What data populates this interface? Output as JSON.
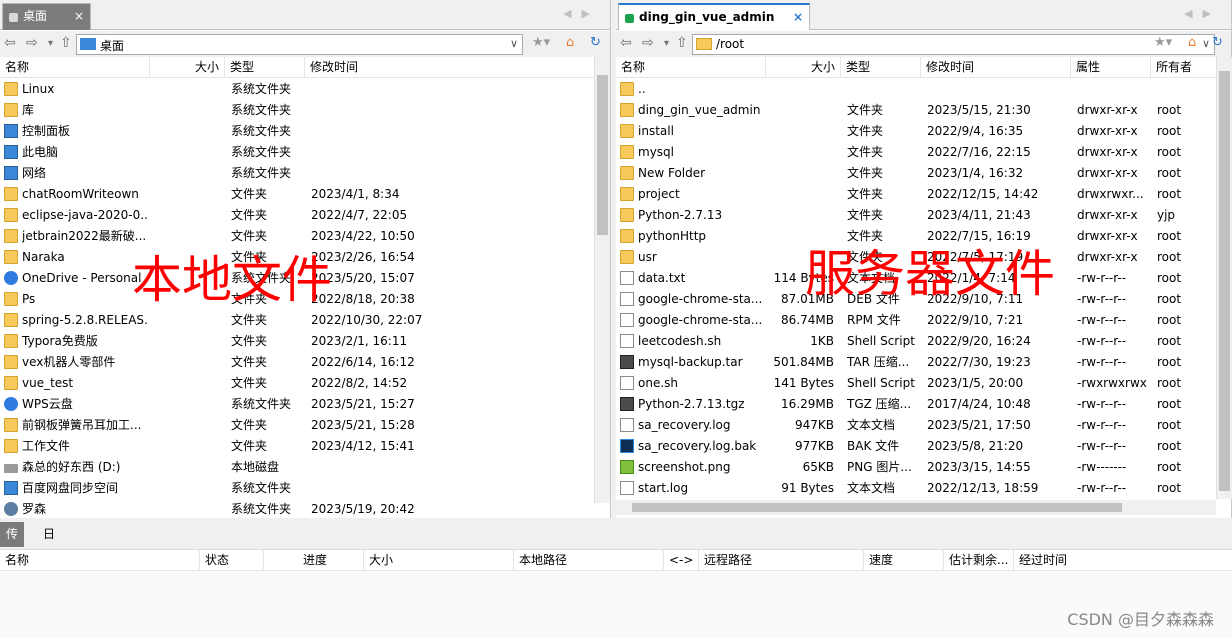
{
  "left": {
    "tab_label": "桌面",
    "path": "桌面",
    "columns": [
      "名称",
      "大小",
      "类型",
      "修改时间"
    ],
    "rows": [
      {
        "name": "Linux",
        "icon": "folder-icon",
        "size": "",
        "type": "系统文件夹",
        "mtime": ""
      },
      {
        "name": "库",
        "icon": "library-icon",
        "size": "",
        "type": "系统文件夹",
        "mtime": ""
      },
      {
        "name": "控制面板",
        "icon": "control-panel-icon",
        "size": "",
        "type": "系统文件夹",
        "mtime": ""
      },
      {
        "name": "此电脑",
        "icon": "computer-icon",
        "size": "",
        "type": "系统文件夹",
        "mtime": ""
      },
      {
        "name": "网络",
        "icon": "network-icon",
        "size": "",
        "type": "系统文件夹",
        "mtime": ""
      },
      {
        "name": "chatRoomWriteown",
        "icon": "folder-icon",
        "size": "",
        "type": "文件夹",
        "mtime": "2023/4/1, 8:34"
      },
      {
        "name": "eclipse-java-2020-0...",
        "icon": "folder-icon",
        "size": "",
        "type": "文件夹",
        "mtime": "2022/4/7, 22:05"
      },
      {
        "name": "jetbrain2022最新破...",
        "icon": "folder-icon",
        "size": "",
        "type": "文件夹",
        "mtime": "2023/4/22, 10:50"
      },
      {
        "name": "Naraka",
        "icon": "folder-icon",
        "size": "",
        "type": "文件夹",
        "mtime": "2023/2/26, 16:54"
      },
      {
        "name": "OneDrive - Personal",
        "icon": "onedrive-icon",
        "size": "",
        "type": "系统文件夹",
        "mtime": "2023/5/20, 15:07"
      },
      {
        "name": "Ps",
        "icon": "folder-icon",
        "size": "",
        "type": "文件夹",
        "mtime": "2022/8/18, 20:38"
      },
      {
        "name": "spring-5.2.8.RELEAS...",
        "icon": "folder-icon",
        "size": "",
        "type": "文件夹",
        "mtime": "2022/10/30, 22:07"
      },
      {
        "name": "Typora免费版",
        "icon": "folder-icon",
        "size": "",
        "type": "文件夹",
        "mtime": "2023/2/1, 16:11"
      },
      {
        "name": "vex机器人零部件",
        "icon": "folder-icon",
        "size": "",
        "type": "文件夹",
        "mtime": "2022/6/14, 16:12"
      },
      {
        "name": "vue_test",
        "icon": "folder-icon",
        "size": "",
        "type": "文件夹",
        "mtime": "2022/8/2, 14:52"
      },
      {
        "name": "WPS云盘",
        "icon": "cloud-icon",
        "size": "",
        "type": "系统文件夹",
        "mtime": "2023/5/21, 15:27"
      },
      {
        "name": "前钢板弹簧吊耳加工...",
        "icon": "folder-icon",
        "size": "",
        "type": "文件夹",
        "mtime": "2023/5/21, 15:28"
      },
      {
        "name": "工作文件",
        "icon": "folder-icon",
        "size": "",
        "type": "文件夹",
        "mtime": "2023/4/12, 15:41"
      },
      {
        "name": "森总的好东西 (D:)",
        "icon": "drive-icon",
        "size": "",
        "type": "本地磁盘",
        "mtime": ""
      },
      {
        "name": "百度网盘同步空间",
        "icon": "baidu-sync-icon",
        "size": "",
        "type": "系统文件夹",
        "mtime": ""
      },
      {
        "name": "罗森",
        "icon": "user-icon",
        "size": "",
        "type": "系统文件夹",
        "mtime": "2023/5/19, 20:42"
      }
    ]
  },
  "right": {
    "tab_label": "ding_gin_vue_admin",
    "path": "/root",
    "columns": [
      "名称",
      "大小",
      "类型",
      "修改时间",
      "属性",
      "所有者"
    ],
    "rows": [
      {
        "name": "..",
        "icon": "folder-icon",
        "size": "",
        "type": "",
        "mtime": "",
        "attr": "",
        "owner": ""
      },
      {
        "name": "ding_gin_vue_admin",
        "icon": "folder-icon",
        "size": "",
        "type": "文件夹",
        "mtime": "2023/5/15, 21:30",
        "attr": "drwxr-xr-x",
        "owner": "root"
      },
      {
        "name": "install",
        "icon": "folder-icon",
        "size": "",
        "type": "文件夹",
        "mtime": "2022/9/4, 16:35",
        "attr": "drwxr-xr-x",
        "owner": "root"
      },
      {
        "name": "mysql",
        "icon": "folder-icon",
        "size": "",
        "type": "文件夹",
        "mtime": "2022/7/16, 22:15",
        "attr": "drwxr-xr-x",
        "owner": "root"
      },
      {
        "name": "New Folder",
        "icon": "folder-icon",
        "size": "",
        "type": "文件夹",
        "mtime": "2023/1/4, 16:32",
        "attr": "drwxr-xr-x",
        "owner": "root"
      },
      {
        "name": "project",
        "icon": "folder-icon",
        "size": "",
        "type": "文件夹",
        "mtime": "2022/12/15, 14:42",
        "attr": "drwxrwxr...",
        "owner": "root"
      },
      {
        "name": "Python-2.7.13",
        "icon": "folder-icon",
        "size": "",
        "type": "文件夹",
        "mtime": "2023/4/11, 21:43",
        "attr": "drwxr-xr-x",
        "owner": "yjp"
      },
      {
        "name": "pythonHttp",
        "icon": "folder-icon",
        "size": "",
        "type": "文件夹",
        "mtime": "2022/7/15, 16:19",
        "attr": "drwxr-xr-x",
        "owner": "root"
      },
      {
        "name": "usr",
        "icon": "folder-icon",
        "size": "",
        "type": "文件夹",
        "mtime": "2022/7/5, 17:19",
        "attr": "drwxr-xr-x",
        "owner": "root"
      },
      {
        "name": "data.txt",
        "icon": "file-icon",
        "size": "114 Bytes",
        "type": "文本文档",
        "mtime": "2022/1/4, 7:14",
        "attr": "-rw-r--r--",
        "owner": "root"
      },
      {
        "name": "google-chrome-sta...",
        "icon": "file-icon",
        "size": "87.01MB",
        "type": "DEB 文件",
        "mtime": "2022/9/10, 7:11",
        "attr": "-rw-r--r--",
        "owner": "root"
      },
      {
        "name": "google-chrome-sta...",
        "icon": "file-icon",
        "size": "86.74MB",
        "type": "RPM 文件",
        "mtime": "2022/9/10, 7:21",
        "attr": "-rw-r--r--",
        "owner": "root"
      },
      {
        "name": "leetcodesh.sh",
        "icon": "script-icon",
        "size": "1KB",
        "type": "Shell Script",
        "mtime": "2022/9/20, 16:24",
        "attr": "-rw-r--r--",
        "owner": "root"
      },
      {
        "name": "mysql-backup.tar",
        "icon": "tar-icon",
        "size": "501.84MB",
        "type": "TAR 压缩...",
        "mtime": "2022/7/30, 19:23",
        "attr": "-rw-r--r--",
        "owner": "root"
      },
      {
        "name": "one.sh",
        "icon": "script-icon",
        "size": "141 Bytes",
        "type": "Shell Script",
        "mtime": "2023/1/5, 20:00",
        "attr": "-rwxrwxrwx",
        "owner": "root"
      },
      {
        "name": "Python-2.7.13.tgz",
        "icon": "tgz-icon",
        "size": "16.29MB",
        "type": "TGZ 压缩...",
        "mtime": "2017/4/24, 10:48",
        "attr": "-rw-r--r--",
        "owner": "root"
      },
      {
        "name": "sa_recovery.log",
        "icon": "file-icon",
        "size": "947KB",
        "type": "文本文档",
        "mtime": "2023/5/21, 17:50",
        "attr": "-rw-r--r--",
        "owner": "root"
      },
      {
        "name": "sa_recovery.log.bak",
        "icon": "photoshop-icon",
        "size": "977KB",
        "type": "BAK 文件",
        "mtime": "2023/5/8, 21:20",
        "attr": "-rw-r--r--",
        "owner": "root"
      },
      {
        "name": "screenshot.png",
        "icon": "png-icon",
        "size": "65KB",
        "type": "PNG 图片...",
        "mtime": "2023/3/15, 14:55",
        "attr": "-rw-------",
        "owner": "root"
      },
      {
        "name": "start.log",
        "icon": "file-icon",
        "size": "91 Bytes",
        "type": "文本文档",
        "mtime": "2022/12/13, 18:59",
        "attr": "-rw-r--r--",
        "owner": "root"
      }
    ]
  },
  "annotations": {
    "local_label": "本地文件",
    "remote_label": "服务器文件"
  },
  "bottom": {
    "tabs": [
      "传输",
      "日志"
    ],
    "columns": [
      "名称",
      "状态",
      "进度",
      "大小",
      "本地路径",
      "<->",
      "远程路径",
      "速度",
      "估计剩余...",
      "经过时间"
    ]
  },
  "watermark": "CSDN @目夕森森森",
  "colors": {
    "annotation_red": "#ff0000",
    "active_tab_gray": "#7c7c7c",
    "session_green": "#1aa34a"
  }
}
